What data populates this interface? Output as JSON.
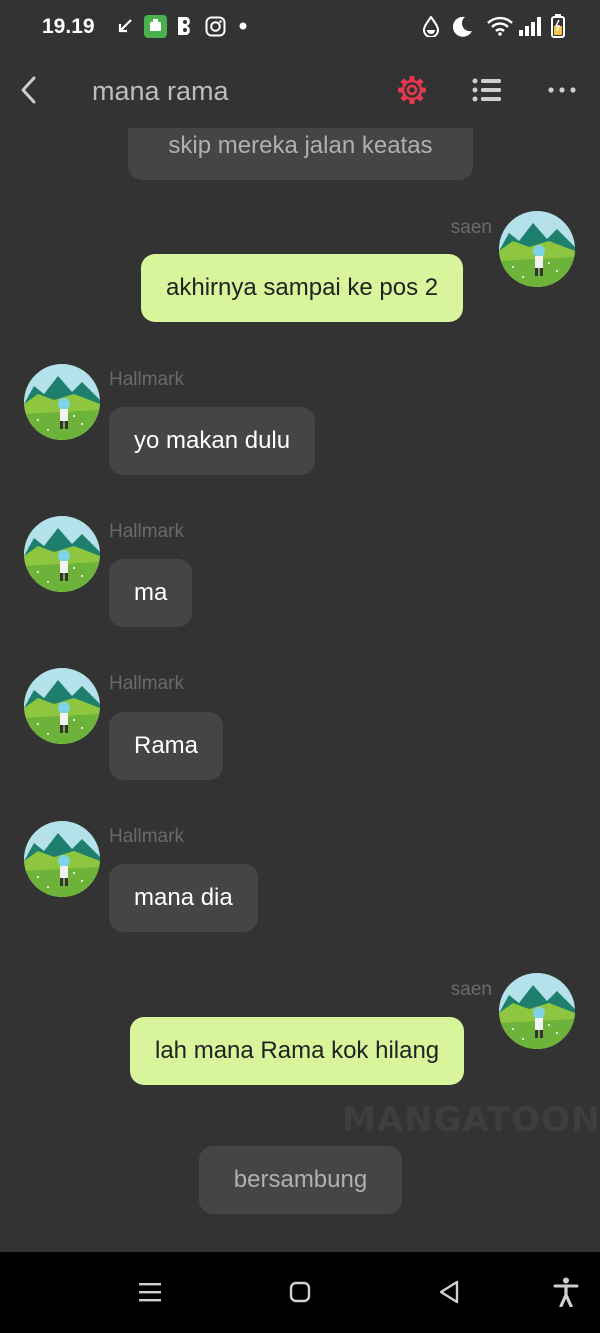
{
  "status_bar": {
    "time": "19.19",
    "icons": [
      "missed-call-arrow-icon",
      "app-notification-icon",
      "app-notification-icon",
      "instagram-icon",
      "dot-icon",
      "water-drop-icon",
      "moon-icon",
      "wifi-icon",
      "signal-icon",
      "battery-icon"
    ]
  },
  "header": {
    "title": "mana rama",
    "accent_color": "#e53950"
  },
  "messages": [
    {
      "type": "narration",
      "text": "skip mereka jalan keatas"
    },
    {
      "type": "outgoing",
      "sender": "saen",
      "text": "akhirnya sampai ke pos 2"
    },
    {
      "type": "incoming",
      "sender": "Hallmark",
      "text": "yo makan dulu"
    },
    {
      "type": "incoming",
      "sender": "Hallmark",
      "text": "ma"
    },
    {
      "type": "incoming",
      "sender": "Hallmark",
      "text": "Rama"
    },
    {
      "type": "incoming",
      "sender": "Hallmark",
      "text": "mana dia"
    },
    {
      "type": "outgoing",
      "sender": "saen",
      "text": "lah mana Rama kok hilang"
    },
    {
      "type": "narration",
      "text": "bersambung"
    }
  ],
  "watermark": "MANGATOON",
  "colors": {
    "background": "#333333",
    "incoming_bubble": "#454545",
    "outgoing_bubble": "#d8f59c",
    "name_text": "#6a6a6a"
  },
  "nav_bar": {
    "icons": [
      "menu-icon",
      "home-icon",
      "back-icon",
      "accessibility-icon"
    ]
  }
}
